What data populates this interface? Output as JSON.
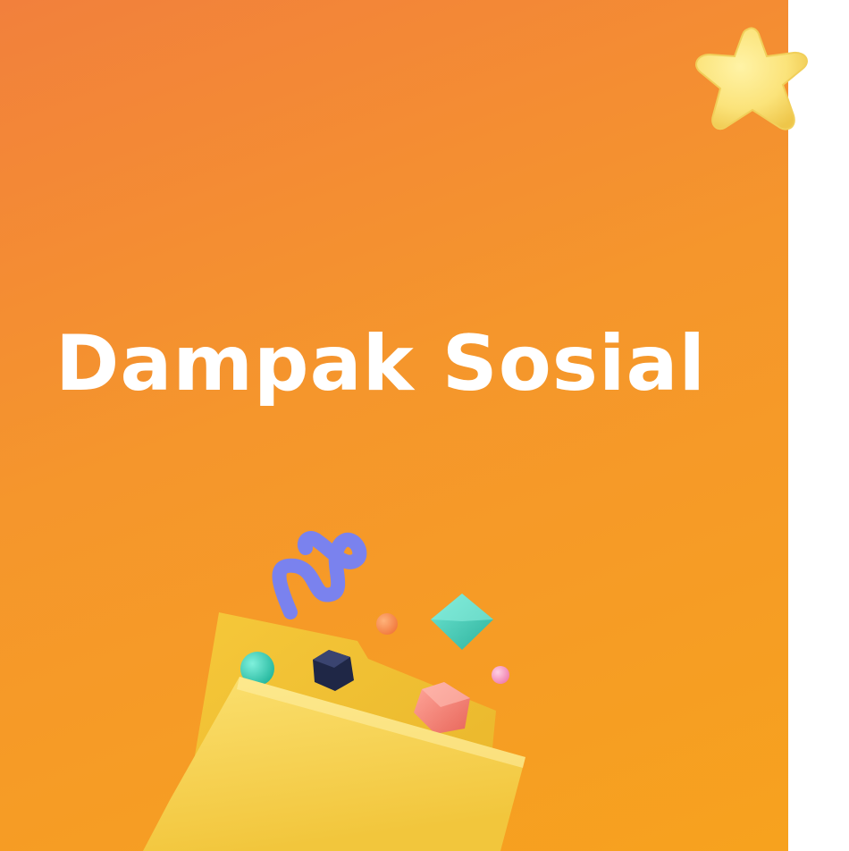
{
  "slide": {
    "title": "Dampak Sosial"
  },
  "colors": {
    "background_top": "#f2803c",
    "background_bottom": "#f7a21e",
    "title_text": "#ffffff",
    "star": "#fbe37a",
    "folder": "#f7d14a",
    "squiggle": "#7a82ee",
    "teal": "#3fcfb8",
    "navy": "#1f2746",
    "coral": "#f47e6e",
    "pink": "#f59ac0"
  },
  "icons": {
    "star": "star-icon",
    "folder": "folder-icon"
  }
}
